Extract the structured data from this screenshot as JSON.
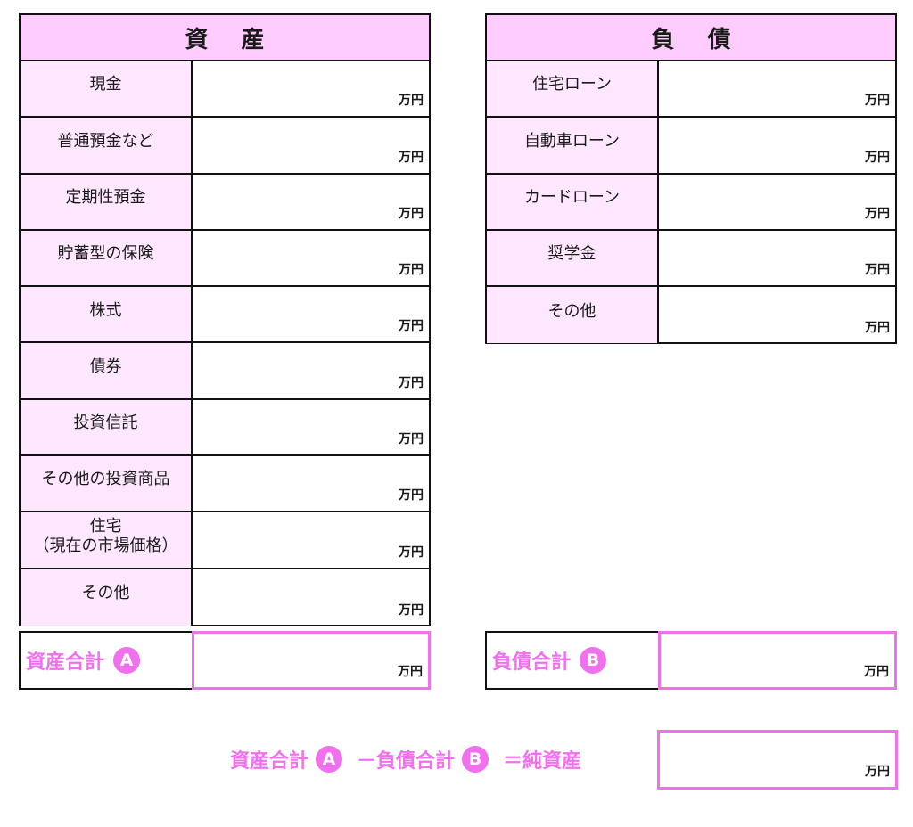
{
  "assets": {
    "title": "資 産",
    "unit": "万円",
    "rows": [
      {
        "label": "現金",
        "value": ""
      },
      {
        "label": "普通預金など",
        "value": ""
      },
      {
        "label": "定期性預金",
        "value": ""
      },
      {
        "label": "貯蓄型の保険",
        "value": ""
      },
      {
        "label": "株式",
        "value": ""
      },
      {
        "label": "債券",
        "value": ""
      },
      {
        "label": "投資信託",
        "value": ""
      },
      {
        "label": "その他の投資商品",
        "value": ""
      },
      {
        "label": "住宅\n（現在の市場価格）",
        "value": ""
      },
      {
        "label": "その他",
        "value": ""
      }
    ],
    "total_label": "資産合計",
    "total_badge": "A",
    "total_value": ""
  },
  "liabilities": {
    "title": "負 債",
    "unit": "万円",
    "rows": [
      {
        "label": "住宅ローン",
        "value": ""
      },
      {
        "label": "自動車ローン",
        "value": ""
      },
      {
        "label": "カードローン",
        "value": ""
      },
      {
        "label": "奨学金",
        "value": ""
      },
      {
        "label": "その他",
        "value": ""
      }
    ],
    "total_label": "負債合計",
    "total_badge": "B",
    "total_value": ""
  },
  "formula": {
    "part1": "資産合計",
    "badge_a": "A",
    "part2": "－負債合計",
    "badge_b": "B",
    "part3": "＝純資産",
    "unit": "万円",
    "value": ""
  },
  "colors": {
    "header_bg": "#ffccff",
    "label_bg": "#ffe8ff",
    "accent": "#f070ee"
  }
}
